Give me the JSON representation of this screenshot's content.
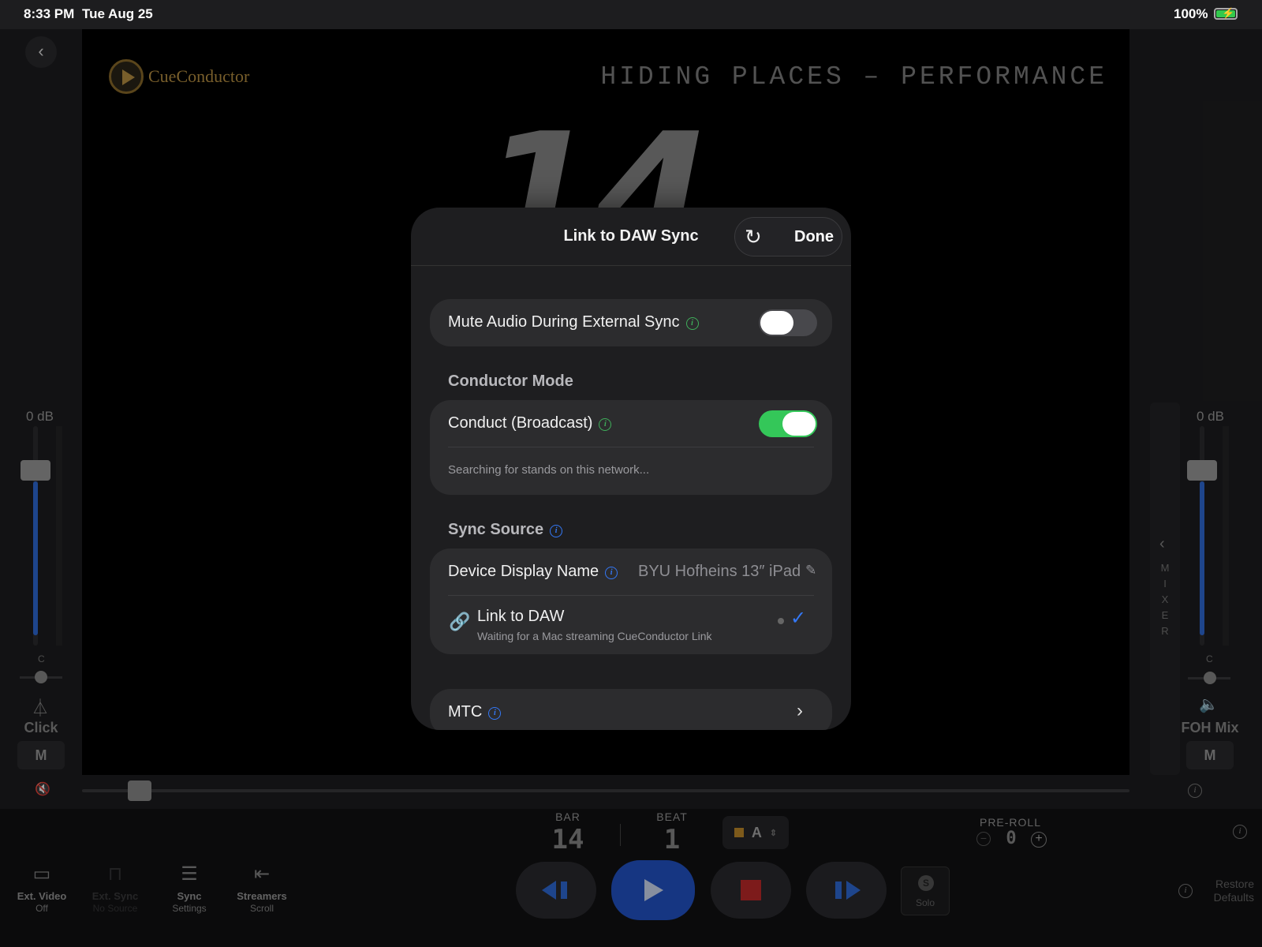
{
  "status_bar": {
    "time": "8:33 PM",
    "date": "Tue Aug 25",
    "battery": "100%"
  },
  "stage": {
    "song_title": "HIDING PLACES – PERFORMANCE",
    "big_bar_number": "14",
    "logo_text": "CueConductor"
  },
  "left_channel": {
    "db": "0 dB",
    "pan": "C",
    "label": "Click",
    "mute": "M",
    "fader_level": 0.74
  },
  "right_channel": {
    "db": "0 dB",
    "pan": "C",
    "label": "FOH Mix",
    "mute": "M",
    "fader_level": 0.74,
    "mixer_tab": "MIXER"
  },
  "scrubber": {
    "position": 0.05
  },
  "counter": {
    "bar_label": "BAR",
    "bar": "14",
    "beat_label": "BEAT",
    "beat": "1",
    "marker": "A",
    "preroll_label": "PRE-ROLL",
    "preroll": "0"
  },
  "toolbar": {
    "ext_video": {
      "title": "Ext. Video",
      "sub": "Off"
    },
    "ext_sync": {
      "title": "Ext. Sync",
      "sub": "No Source"
    },
    "sync_settings": {
      "title": "Sync",
      "sub": "Settings"
    },
    "streamers": {
      "title": "Streamers",
      "sub": "Scroll"
    },
    "solo": {
      "letter": "S",
      "label": "Solo"
    },
    "restore": {
      "line1": "Restore",
      "line2": "Defaults"
    }
  },
  "modal": {
    "title": "Link to DAW Sync",
    "done": "Done",
    "mute_audio": {
      "label": "Mute Audio During External Sync",
      "on": false
    },
    "conductor_section": "Conductor Mode",
    "conduct": {
      "label": "Conduct (Broadcast)",
      "on": true,
      "status": "Searching for stands on this network..."
    },
    "sync_section": "Sync Source",
    "device_name": {
      "label": "Device Display Name",
      "value": "BYU Hofheins 13″ iPad"
    },
    "link_daw": {
      "title": "Link to DAW",
      "subtitle": "Waiting for a Mac streaming CueConductor Link",
      "selected": true
    },
    "mtc": {
      "label": "MTC"
    }
  },
  "colors": {
    "accent_blue": "#2354c8",
    "toggle_green": "#34c759",
    "fader_blue": "#2f6ad8",
    "logo_gold": "#b89143"
  }
}
